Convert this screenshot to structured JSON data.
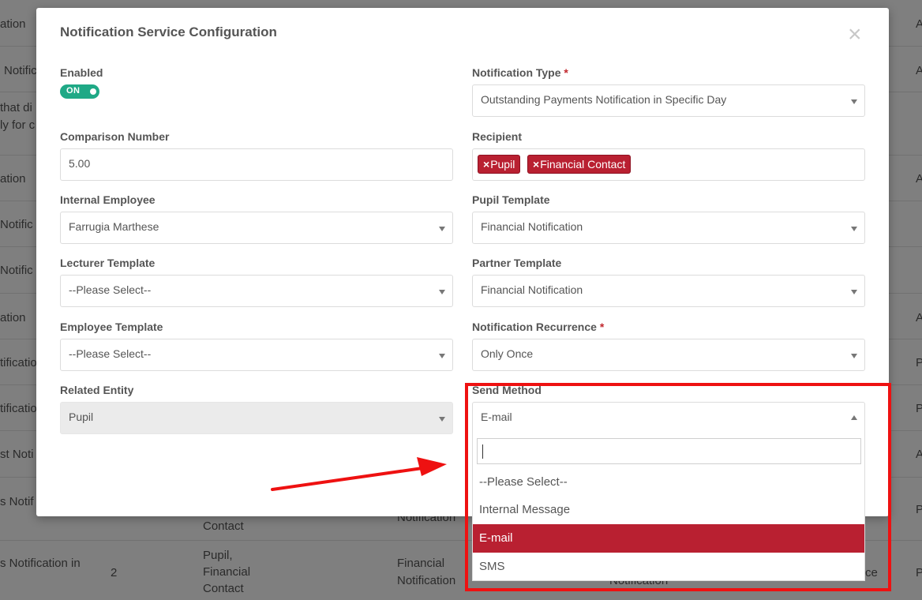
{
  "background_table": {
    "rows": [
      {
        "col1": "ation",
        "col5": "A"
      },
      {
        "col1": "Notific",
        "col5": "A"
      },
      {
        "col1": "that di",
        "col1b": "ly for c"
      },
      {
        "col1": "ation",
        "col5": "A"
      },
      {
        "col1": "Notific"
      },
      {
        "col1": "Notific"
      },
      {
        "col1": "ation",
        "col5": "A"
      },
      {
        "col1": "tificatio",
        "col5": "P"
      },
      {
        "col1": "tificatio",
        "col5": "P"
      },
      {
        "col1": "st Noti",
        "col5": "A"
      },
      {
        "col1": "s Notif",
        "col3": "Contact",
        "col4": "Notification",
        "col5": "P"
      },
      {
        "col1": "s Notification in",
        "col2": "2",
        "col3a": "Pupil,",
        "col3b": "Financial",
        "col3c": "Contact",
        "col4a": "Financial",
        "col4b": "Notification",
        "col4c": "Notification",
        "col4d": "ce",
        "col5": "P"
      }
    ]
  },
  "modal": {
    "title": "Notification Service Configuration",
    "close_symbol": "×",
    "enabled": {
      "label": "Enabled",
      "toggle_text": "ON"
    },
    "notification_type": {
      "label": "Notification Type",
      "required": "*",
      "value": "Outstanding Payments Notification in Specific Day"
    },
    "comparison_number": {
      "label": "Comparison Number",
      "value": "5.00"
    },
    "recipient": {
      "label": "Recipient",
      "tags": [
        "Pupil",
        "Financial Contact"
      ],
      "tag_remove": "×"
    },
    "internal_employee": {
      "label": "Internal Employee",
      "value": "Farrugia Marthese"
    },
    "pupil_template": {
      "label": "Pupil Template",
      "value": "Financial Notification"
    },
    "lecturer_template": {
      "label": "Lecturer Template",
      "value": "--Please Select--"
    },
    "partner_template": {
      "label": "Partner Template",
      "value": "Financial Notification"
    },
    "employee_template": {
      "label": "Employee Template",
      "value": "--Please Select--"
    },
    "notification_recurrence": {
      "label": "Notification Recurrence",
      "required": "*",
      "value": "Only Once"
    },
    "related_entity": {
      "label": "Related Entity",
      "value": "Pupil"
    },
    "send_method": {
      "label": "Send Method",
      "value": "E-mail",
      "search_value": "",
      "options": [
        "--Please Select--",
        "Internal Message",
        "E-mail",
        "SMS"
      ],
      "selected_index": 2
    }
  },
  "colors": {
    "accent": "#b92031",
    "toggle": "#1fa986",
    "annotation": "#ee1111"
  }
}
